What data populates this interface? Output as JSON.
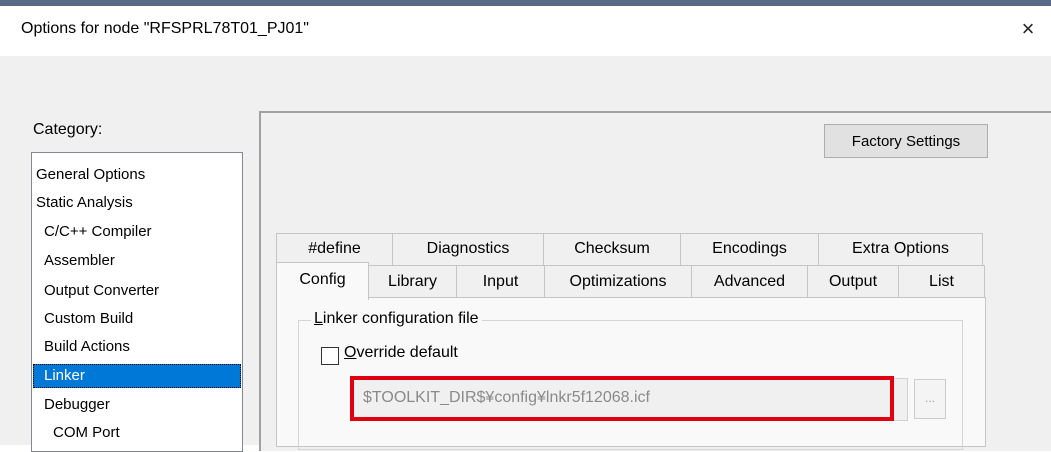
{
  "window": {
    "title": "Options for node \"RFSPRL78T01_PJ01\"",
    "close_glyph": "×"
  },
  "category": {
    "label": "Category:",
    "items": [
      {
        "label": "General Options",
        "level": 0,
        "selected": false
      },
      {
        "label": "Static Analysis",
        "level": 0,
        "selected": false
      },
      {
        "label": "C/C++ Compiler",
        "level": 1,
        "selected": false
      },
      {
        "label": "Assembler",
        "level": 1,
        "selected": false
      },
      {
        "label": "Output Converter",
        "level": 1,
        "selected": false
      },
      {
        "label": "Custom Build",
        "level": 1,
        "selected": false
      },
      {
        "label": "Build Actions",
        "level": 1,
        "selected": false
      },
      {
        "label": "Linker",
        "level": 1,
        "selected": true
      },
      {
        "label": "Debugger",
        "level": 1,
        "selected": false
      },
      {
        "label": "COM Port",
        "level": 2,
        "selected": false
      }
    ]
  },
  "toolbar": {
    "factory_settings": "Factory Settings"
  },
  "tabs": {
    "row1": [
      "#define",
      "Diagnostics",
      "Checksum",
      "Encodings",
      "Extra Options"
    ],
    "row2": [
      "Config",
      "Library",
      "Input",
      "Optimizations",
      "Advanced",
      "Output",
      "List"
    ],
    "active": "Config"
  },
  "config": {
    "group_label_mnemonic": "L",
    "group_label_rest": "inker configuration file",
    "override_mnemonic": "O",
    "override_rest": "verride default",
    "override_checked": false,
    "file_path": "$TOOLKIT_DIR$¥config¥lnkr5f12068.icf",
    "browse_label": "...",
    "highlight_color": "#e1000f"
  },
  "colors": {
    "selection": "#0078d7",
    "dialog_bg": "#f0f0f0"
  }
}
